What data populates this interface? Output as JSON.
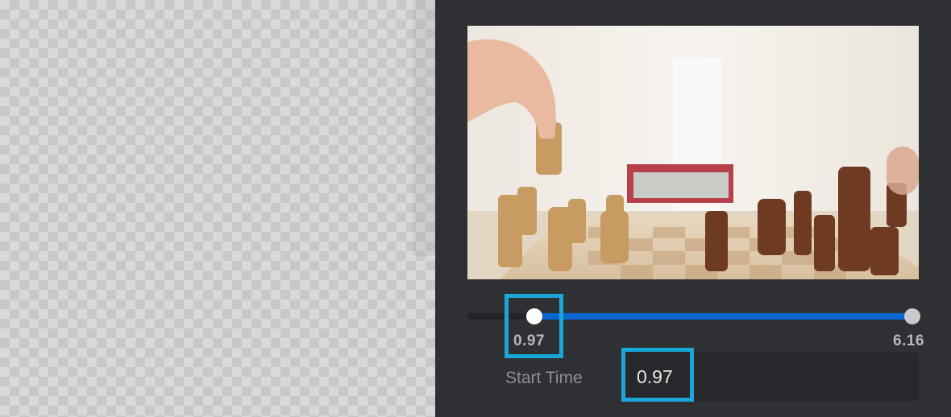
{
  "preview": {
    "icon": "chess-game-video-frame"
  },
  "trim": {
    "start_value": "0.97",
    "end_value": "6.16",
    "start_position": 0.148,
    "colors": {
      "fill": "#0a67d0",
      "highlight": "#1aa7d8"
    }
  },
  "start_time": {
    "label": "Start Time",
    "value": "0.97"
  }
}
